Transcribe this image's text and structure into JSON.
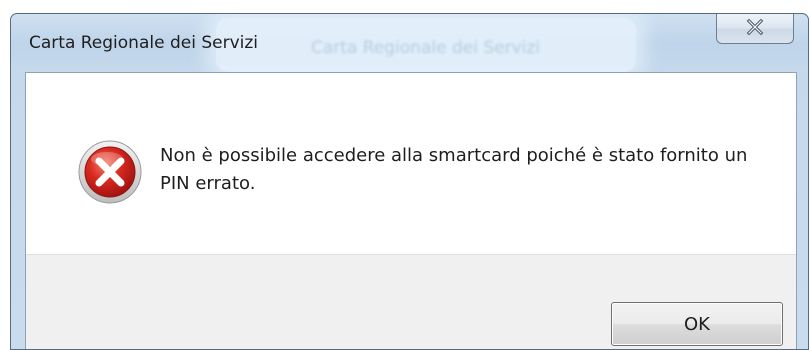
{
  "window": {
    "title": "Carta Regionale dei Servizi",
    "background_title": "Carta Regionale dei Servizi"
  },
  "titlebar": {
    "close_icon": "close-x-icon"
  },
  "message": {
    "icon": "error-icon",
    "text": "Non è possibile accedere alla smartcard poiché è stato fornito un PIN errato."
  },
  "buttons": {
    "ok_label": "OK"
  },
  "colors": {
    "error_red": "#c9201b",
    "frame_blue": "#c4d8ec"
  }
}
